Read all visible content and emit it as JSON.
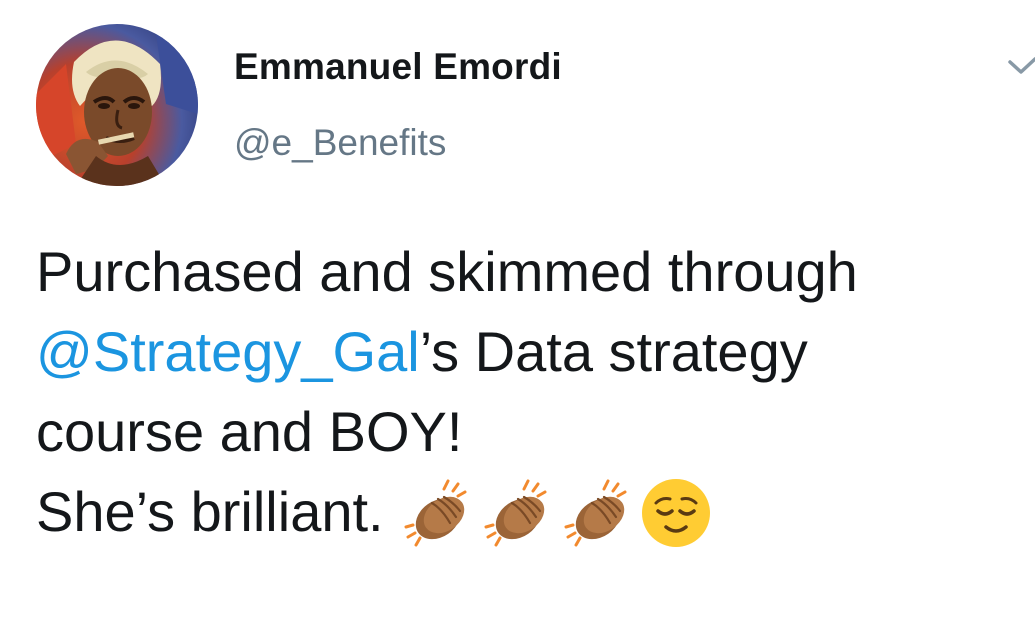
{
  "author": {
    "display_name": "Emmanuel Emordi",
    "handle": "@e_Benefits"
  },
  "tweet": {
    "line1": "Purchased and skimmed through",
    "mention": "@Strategy_Gal",
    "line2_rest": "’s Data strategy",
    "line3": "course and BOY!",
    "line4": "She’s brilliant.",
    "emojis": [
      "clapping-hands-emoji",
      "clapping-hands-emoji",
      "clapping-hands-emoji",
      "relieved-face-emoji"
    ]
  },
  "colors": {
    "mention": "#1b95e0",
    "handle": "#657786",
    "text": "#14171a"
  },
  "icons": {
    "menu": "chevron-down-icon"
  }
}
